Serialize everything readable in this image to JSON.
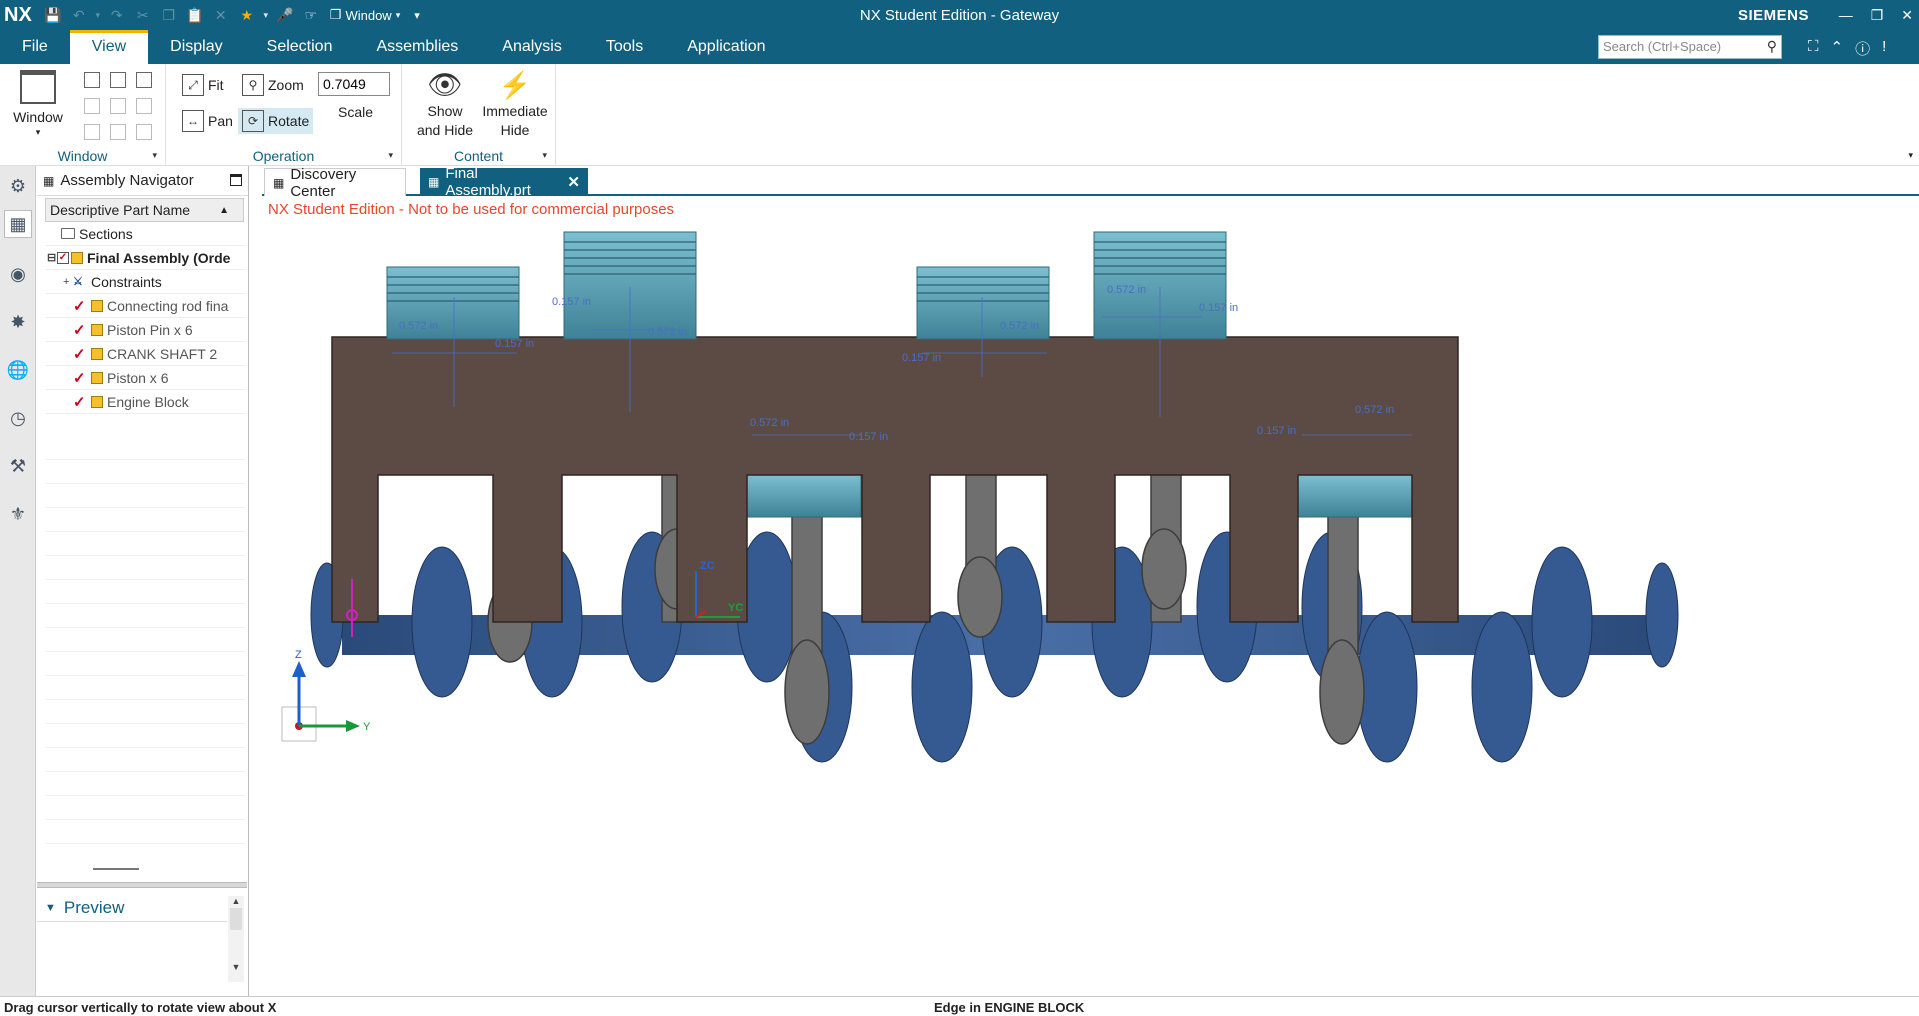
{
  "app": {
    "logo": "NX",
    "title": "NX Student Edition - Gateway",
    "brand": "SIEMENS",
    "quick_access_window": "Window"
  },
  "menu": {
    "items": [
      "File",
      "View",
      "Display",
      "Selection",
      "Assemblies",
      "Analysis",
      "Tools",
      "Application"
    ],
    "active": "View",
    "search_placeholder": "Search (Ctrl+Space)"
  },
  "ribbon": {
    "window_group": {
      "label": "Window",
      "button": "Window"
    },
    "operation_group": {
      "label": "Operation",
      "fit": "Fit",
      "zoom": "Zoom",
      "pan": "Pan",
      "rotate": "Rotate",
      "scale_value": "0.7049",
      "scale_label": "Scale"
    },
    "content_group": {
      "label": "Content",
      "show_hide_1": "Show",
      "show_hide_2": "and Hide",
      "immediate_hide_1": "Immediate",
      "immediate_hide_2": "Hide"
    }
  },
  "navigator": {
    "title": "Assembly Navigator",
    "column": "Descriptive Part Name",
    "rows": [
      {
        "label": "Sections",
        "kind": "folder"
      },
      {
        "label": "Final Assembly (Orde",
        "kind": "assembly"
      },
      {
        "label": "Constraints",
        "kind": "constraints"
      },
      {
        "label": "Connecting rod fina",
        "kind": "part"
      },
      {
        "label": "Piston Pin x 6",
        "kind": "part"
      },
      {
        "label": "CRANK SHAFT 2",
        "kind": "part"
      },
      {
        "label": "Piston x 6",
        "kind": "part"
      },
      {
        "label": "Engine Block",
        "kind": "part"
      }
    ],
    "preview": "Preview"
  },
  "tabs": [
    {
      "label": "Discovery Center",
      "active": false
    },
    {
      "label": "Final Assembly.prt",
      "active": true
    }
  ],
  "viewport": {
    "watermark": "NX Student Edition - Not to be used for commercial purposes",
    "dims": [
      "0.572 in",
      "0.157 in",
      "0.157 in",
      "0.572 in",
      "0.157 in",
      "0.572 in",
      "0.157 in",
      "0.572 in",
      "0.157 in",
      "0.572 in",
      "0.157 in",
      "0.572 in"
    ],
    "triad": {
      "z": "Z",
      "y": "Y"
    },
    "wcs": {
      "z": "ZC",
      "y": "YC"
    }
  },
  "status": {
    "left": "Drag cursor vertically to rotate view about X",
    "middle": "Edge in ENGINE BLOCK"
  },
  "colors": {
    "accent": "#11607f",
    "highlight": "#f2b300",
    "piston": "#5b9fb3",
    "block": "#5a4a44",
    "crank": "#37598f",
    "rod": "#6c6c6c"
  }
}
